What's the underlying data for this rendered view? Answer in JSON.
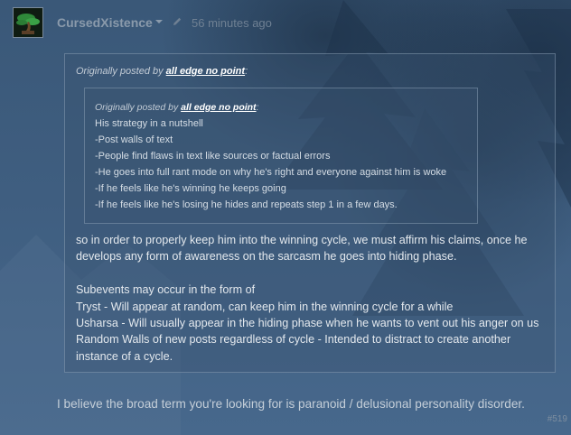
{
  "author": {
    "name": "CursedXistence",
    "timestamp": "56 minutes ago",
    "avatar_icon": "bonsai-tree-icon"
  },
  "outer_quote": {
    "prefix": "Originally posted by ",
    "author": "all edge no point",
    "suffix": ":",
    "inner_quote": {
      "prefix": "Originally posted by ",
      "author": "all edge no point",
      "suffix": ":",
      "lines": [
        "His strategy in a nutshell",
        "-Post walls of text",
        "-People find flaws in text like sources or factual errors",
        "-He goes into full rant mode on why he's right and everyone against him is woke",
        "-If he feels like he's winning he keeps going",
        "-If he feels like he's losing he hides and repeats step 1 in a few days."
      ]
    },
    "reply_lines": [
      "so in order to properly keep him into the winning cycle, we must affirm his claims, once he",
      "develops any form of awareness on the sarcasm he goes into hiding phase.",
      "",
      "Subevents may occur in the form of",
      "Tryst - Will appear at random, can keep him in the winning cycle for a while",
      "Usharsa - Will usually appear in the hiding phase when he wants to vent out his anger on us",
      "Random Walls of new posts regardless of cycle - Intended to distract to create another",
      "instance of a cycle."
    ]
  },
  "comment_text": "I believe the broad term you're looking for is paranoid / delusional personality disorder.",
  "comment_number": "#519"
}
